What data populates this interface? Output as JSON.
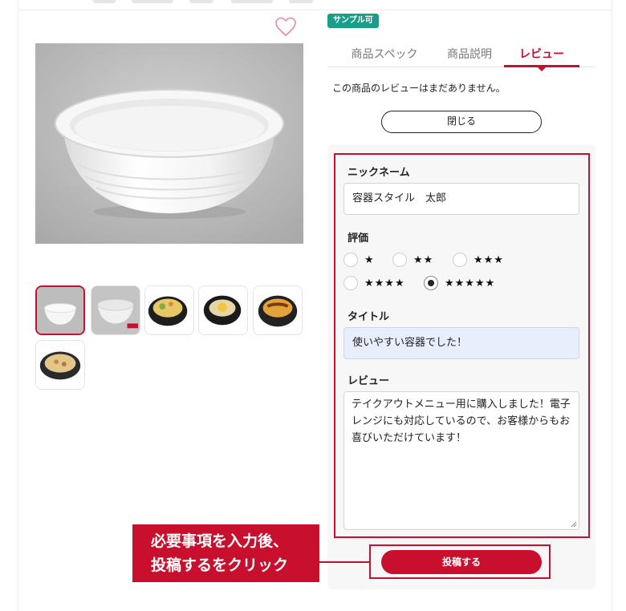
{
  "badge": "サンプル可",
  "tabs": [
    {
      "label": "商品スペック"
    },
    {
      "label": "商品説明"
    },
    {
      "label": "レビュー"
    }
  ],
  "active_tab": "レビュー",
  "no_review_text": "この商品のレビューはまだありません。",
  "close_button": "閉じる",
  "form": {
    "nickname_label": "ニックネーム",
    "nickname_value": "容器スタイル　太郎",
    "rating_label": "評価",
    "rating_options": [
      "★",
      "★★",
      "★★★",
      "★★★★",
      "★★★★★"
    ],
    "rating_selected": 5,
    "title_label": "タイトル",
    "title_value": "使いやすい容器でした！",
    "review_label": "レビュー",
    "review_lines": [
      "テイクアウトメニュー用に購入しました！電子",
      "レンジにも対応しているので、お客様からもお",
      "喜びいただけています！"
    ],
    "submit_button": "投稿する"
  },
  "callout": {
    "line1": "必要事項を入力後、",
    "line2": "投稿するをクリック"
  },
  "thumbnail_count": 6,
  "selected_thumbnail": 1,
  "colors": {
    "accent": "#c8102e",
    "badge": "#1a9e8a",
    "title_field_fill": "#e8eefc"
  }
}
